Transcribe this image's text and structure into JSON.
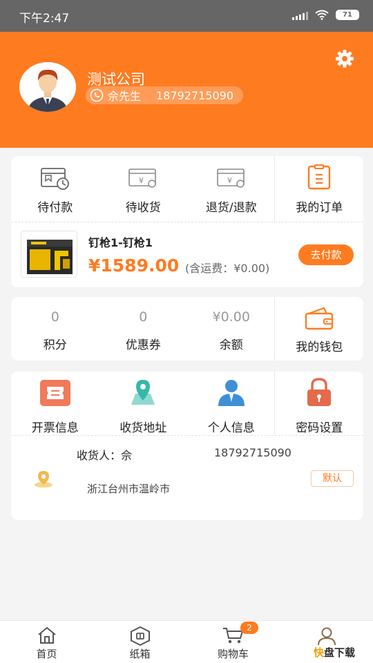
{
  "status_bar": {
    "time": "下午2:47",
    "battery": "71"
  },
  "profile": {
    "company": "测试公司",
    "contact_name": "佘先生",
    "phone": "18792715090"
  },
  "orders": {
    "items": [
      {
        "label": "待付款",
        "icon": "pending-payment-icon"
      },
      {
        "label": "待收货",
        "icon": "pending-receipt-icon"
      },
      {
        "label": "退货/退款",
        "icon": "refund-icon"
      },
      {
        "label": "我的订单",
        "icon": "orders-icon"
      }
    ],
    "product": {
      "name": "钉枪1-钉枪1",
      "price": "¥1589.00",
      "shipping": "(含运费：¥0.00)",
      "pay_label": "去付款"
    }
  },
  "wallet": {
    "stats": [
      {
        "value": "0",
        "label": "积分"
      },
      {
        "value": "0",
        "label": "优惠券"
      },
      {
        "value": "¥0.00",
        "label": "余额"
      }
    ],
    "wallet_label": "我的钱包"
  },
  "services": {
    "items": [
      {
        "label": "开票信息",
        "icon": "invoice-icon"
      },
      {
        "label": "收货地址",
        "icon": "location-map-icon"
      },
      {
        "label": "个人信息",
        "icon": "person-icon"
      },
      {
        "label": "密码设置",
        "icon": "lock-icon"
      }
    ],
    "address": {
      "receiver": "收货人：佘",
      "phone": "18792715090",
      "address": "浙江台州市温岭市",
      "default_label": "默认"
    }
  },
  "tabbar": {
    "tabs": [
      {
        "label": "首页",
        "icon": "home-icon"
      },
      {
        "label": "纸箱",
        "icon": "box-icon"
      },
      {
        "label": "购物车",
        "icon": "cart-icon",
        "badge": "2"
      },
      {
        "label": "",
        "icon": "user-icon"
      }
    ]
  },
  "watermark": {
    "brand_char": "快",
    "text": "盘下载"
  },
  "colors": {
    "accent": "#ff7b20",
    "status_bar": "#666666",
    "teal": "#36b8a8",
    "blue": "#3f8fd6"
  }
}
